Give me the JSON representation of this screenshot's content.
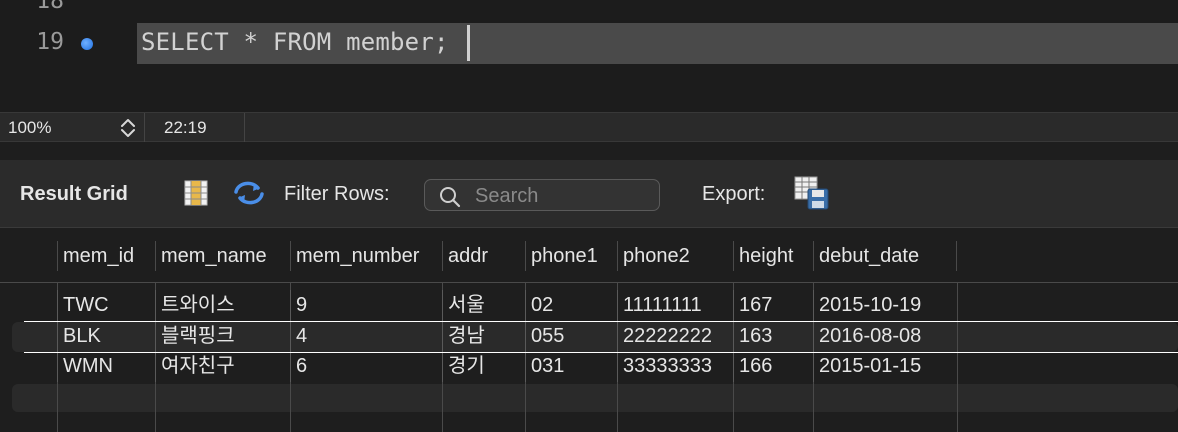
{
  "editor": {
    "lines": [
      {
        "number": "18",
        "code": ""
      },
      {
        "number": "19",
        "code": "SELECT * FROM member;"
      }
    ]
  },
  "statusbar": {
    "zoom": "100%",
    "cursor_position": "22:19"
  },
  "toolbar": {
    "result_grid_label": "Result Grid",
    "filter_label": "Filter Rows:",
    "search_placeholder": "Search",
    "export_label": "Export:"
  },
  "grid": {
    "columns": [
      "mem_id",
      "mem_name",
      "mem_number",
      "addr",
      "phone1",
      "phone2",
      "height",
      "debut_date"
    ],
    "rows": [
      [
        "TWC",
        "트와이스",
        "9",
        "서울",
        "02",
        "11111111",
        "167",
        "2015-10-19"
      ],
      [
        "BLK",
        "블랙핑크",
        "4",
        "경남",
        "055",
        "22222222",
        "163",
        "2016-08-08"
      ],
      [
        "WMN",
        "여자친구",
        "6",
        "경기",
        "031",
        "33333333",
        "166",
        "2015-01-15"
      ]
    ]
  },
  "colors": {
    "breakpoint": "#1f6fe0",
    "selection": "#4a4a4a",
    "background": "#1e1e1e"
  }
}
